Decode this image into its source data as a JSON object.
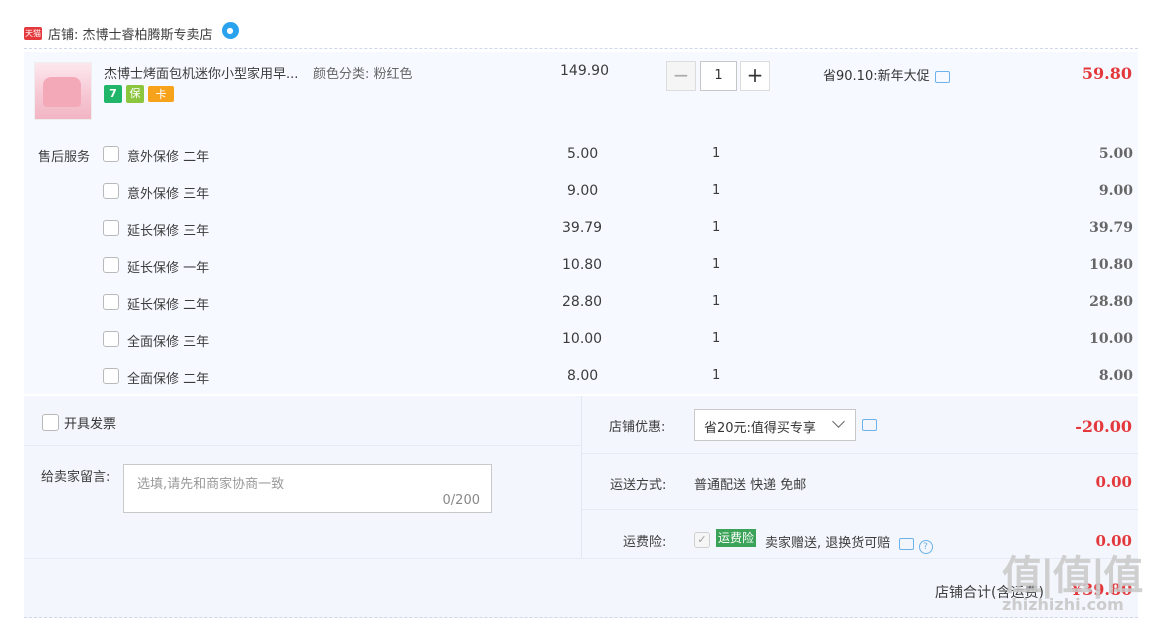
{
  "shop": {
    "badge": "天猫",
    "label": "店铺: 杰博士睿柏腾斯专卖店"
  },
  "product": {
    "title": "杰博士烤面包机迷你小型家用早...",
    "attribute": "颜色分类: 粉红色",
    "price": "149.90",
    "quantity": "1",
    "promo": "省90.10:新年大促",
    "total": "59.80",
    "badges": [
      "7",
      "保",
      "卡"
    ]
  },
  "service": {
    "label": "售后服务",
    "items": [
      {
        "name": "意外保修 二年",
        "price": "5.00",
        "qty": "1",
        "total": "5.00"
      },
      {
        "name": "意外保修 三年",
        "price": "9.00",
        "qty": "1",
        "total": "9.00"
      },
      {
        "name": "延长保修 三年",
        "price": "39.79",
        "qty": "1",
        "total": "39.79"
      },
      {
        "name": "延长保修 一年",
        "price": "10.80",
        "qty": "1",
        "total": "10.80"
      },
      {
        "name": "延长保修 二年",
        "price": "28.80",
        "qty": "1",
        "total": "28.80"
      },
      {
        "name": "全面保修 三年",
        "price": "10.00",
        "qty": "1",
        "total": "10.00"
      },
      {
        "name": "全面保修 二年",
        "price": "8.00",
        "qty": "1",
        "total": "8.00"
      }
    ]
  },
  "invoice": {
    "label": "开具发票"
  },
  "message": {
    "label": "给卖家留言:",
    "placeholder": "选填,请先和商家协商一致",
    "count": "0/200"
  },
  "discount": {
    "label": "店铺优惠:",
    "selected": "省20元:值得买专享",
    "amount": "-20.00"
  },
  "shipping": {
    "label": "运送方式:",
    "value": "普通配送 快递 免邮",
    "amount": "0.00"
  },
  "insurance": {
    "label": "运费险:",
    "tag": "运费险",
    "desc": "卖家赠送, 退换货可赔",
    "amount": "0.00"
  },
  "store_total": {
    "label": "店铺合计(含运费)",
    "amount": "¥39.80"
  },
  "watermark": {
    "text": "值|值|值",
    "url": "zhizhizhi.com"
  },
  "colors": {
    "accent_red": "#e4393c",
    "block_bg": "#f6f9ff",
    "tag_green": "#3aa357"
  }
}
